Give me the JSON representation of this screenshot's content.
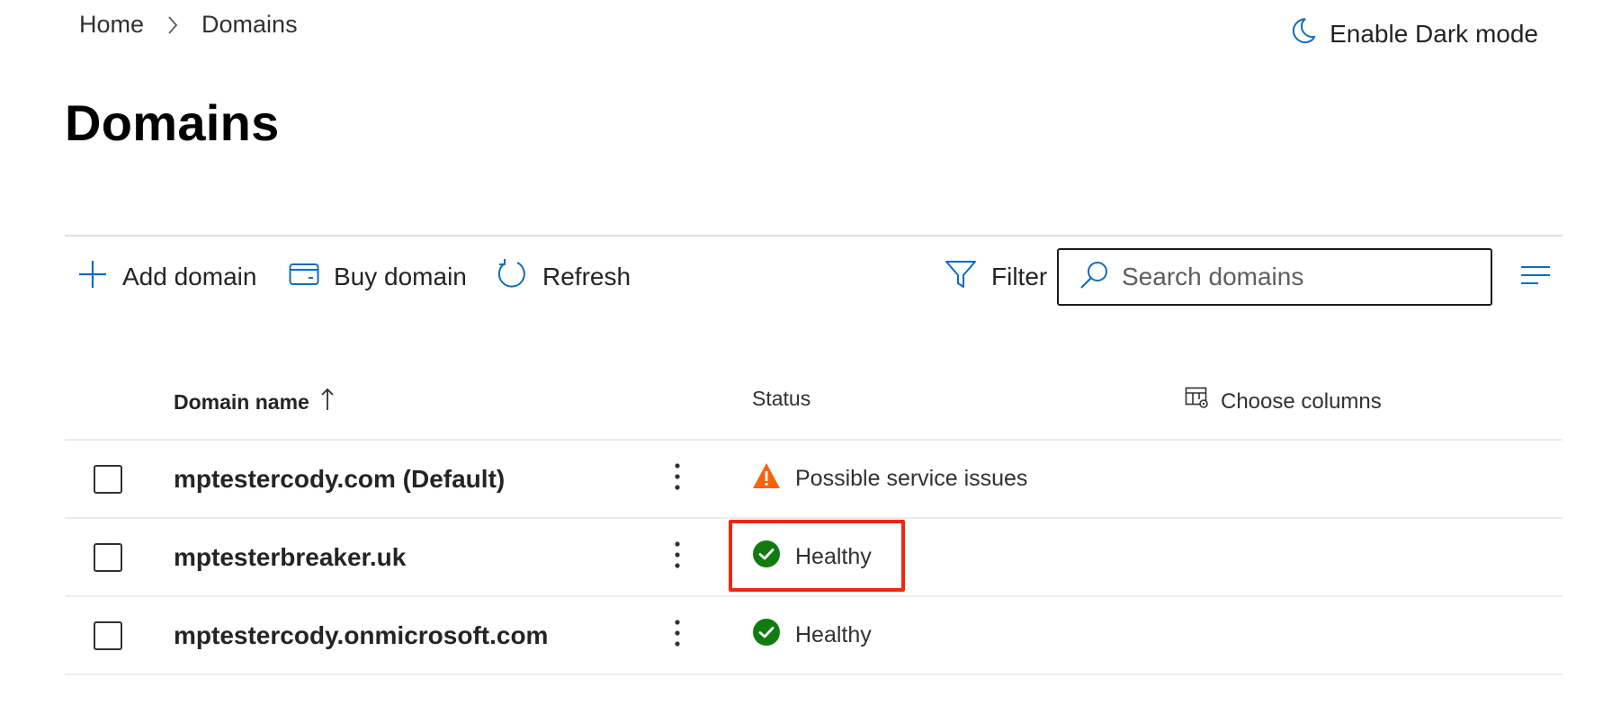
{
  "breadcrumb": {
    "home": "Home",
    "current": "Domains"
  },
  "header": {
    "dark_mode_label": "Enable Dark mode"
  },
  "page": {
    "title": "Domains"
  },
  "toolbar": {
    "add_label": "Add domain",
    "buy_label": "Buy domain",
    "refresh_label": "Refresh",
    "filter_label": "Filter",
    "search_placeholder": "Search domains"
  },
  "table": {
    "columns": {
      "domain": "Domain name",
      "status": "Status",
      "choose_columns": "Choose columns"
    },
    "rows": [
      {
        "domain": "mptestercody.com (Default)",
        "status": "Possible service issues",
        "status_type": "warning"
      },
      {
        "domain": "mptesterbreaker.uk",
        "status": "Healthy",
        "status_type": "healthy"
      },
      {
        "domain": "mptestercody.onmicrosoft.com",
        "status": "Healthy",
        "status_type": "healthy"
      }
    ]
  },
  "colors": {
    "accent": "#0f6cbd",
    "healthy": "#107c10",
    "warning": "#f7630c",
    "highlight": "#f0260e"
  },
  "icons": [
    "chevron-right-icon",
    "moon-icon",
    "plus-icon",
    "credit-card-icon",
    "refresh-icon",
    "filter-icon",
    "search-icon",
    "list-view-icon",
    "sort-up-arrow-icon",
    "choose-columns-icon",
    "more-vertical-icon",
    "warning-icon",
    "checkmark-circle-icon"
  ]
}
